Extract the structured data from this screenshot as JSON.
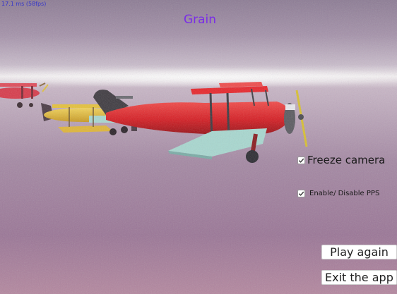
{
  "overlay": {
    "fps_text": "17.1 ms (58fps)",
    "title": "Grain"
  },
  "controls": {
    "freeze_camera": {
      "label": "Freeze camera",
      "checked": true
    },
    "pps_toggle": {
      "label": "Enable/ Disable PPS",
      "checked": true
    }
  },
  "buttons": {
    "play_again": "Play again",
    "exit_app": "Exit the app"
  },
  "scene": {
    "description_colors": {
      "sky_top": "#8e7a92",
      "sky_mid": "#e8e0e6",
      "sky_bottom": "#a57a9c",
      "plane_main": "#e8242a",
      "wing_under": "#a8d8d0",
      "plane_yellow": "#e6c23a"
    }
  }
}
